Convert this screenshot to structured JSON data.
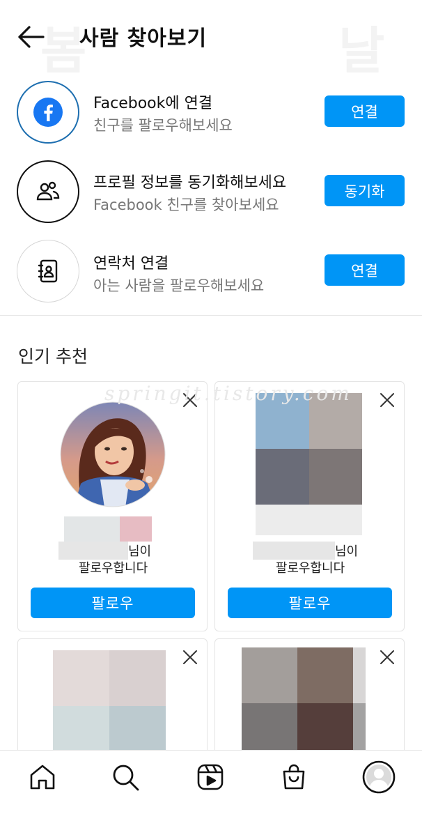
{
  "header": {
    "title": "사람 찾아보기",
    "wm_left": "봄",
    "wm_right": "날"
  },
  "connections": [
    {
      "title": "Facebook에 연결",
      "subtitle": "친구를 팔로우해보세요",
      "button": "연결",
      "icon": "facebook-icon"
    },
    {
      "title": "프로필 정보를 동기화해보세요",
      "subtitle": "Facebook 친구를 찾아보세요",
      "button": "동기화",
      "icon": "people-icon"
    },
    {
      "title": "연락처 연결",
      "subtitle": "아는 사람을 팔로우해보세요",
      "button": "연결",
      "icon": "contacts-icon"
    }
  ],
  "section": {
    "title": "인기 추천"
  },
  "watermark": "springit.tistory.com",
  "cards": [
    {
      "line1": "님이",
      "line2": "팔로우합니다",
      "button": "팔로우"
    },
    {
      "line1": "님이",
      "line2": "팔로우합니다",
      "button": "팔로우"
    }
  ],
  "nav": [
    "home-icon",
    "search-icon",
    "reels-icon",
    "shop-icon",
    "profile-avatar"
  ],
  "colors": {
    "accent": "#0095f6",
    "facebook": "#1877f2"
  }
}
